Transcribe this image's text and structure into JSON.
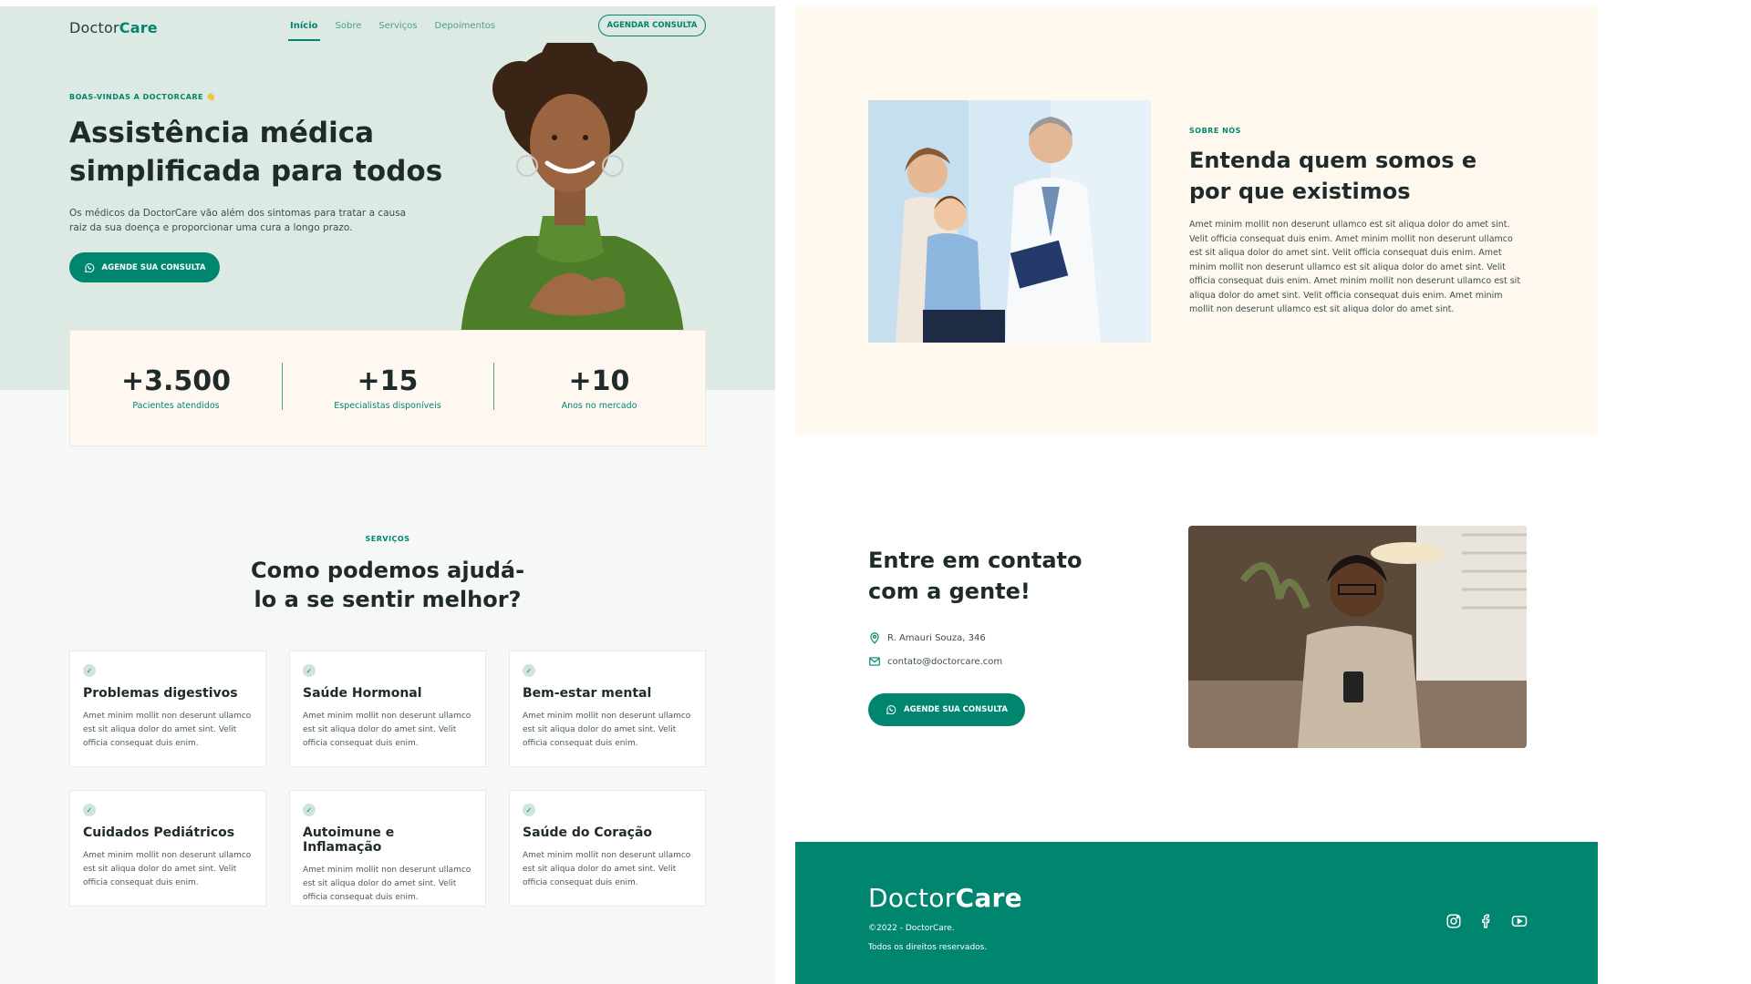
{
  "brand": {
    "name_part1": "Doctor",
    "name_part2": "Care",
    "primary": "#00856f",
    "hero_bg": "#dde9e3",
    "cream": "#fff8ef"
  },
  "nav": {
    "items": [
      "Início",
      "Sobre",
      "Serviços",
      "Depoimentos"
    ],
    "cta": "AGENDAR CONSULTA"
  },
  "hero": {
    "eyebrow": "BOAS-VINDAS A DOCTORCARE 👋",
    "title": "Assistência médica simplificada para todos",
    "text": "Os médicos da DoctorCare vão além dos sintomas para tratar a causa raiz da sua doença e proporcionar uma cura a longo prazo.",
    "button": "AGENDE SUA CONSULTA"
  },
  "stats": [
    {
      "value": "+3.500",
      "label": "Pacientes atendidos"
    },
    {
      "value": "+15",
      "label": "Especialistas disponíveis"
    },
    {
      "value": "+10",
      "label": "Anos no mercado"
    }
  ],
  "services": {
    "eyebrow": "SERVIÇOS",
    "title": "Como podemos ajudá-lo a se sentir melhor?",
    "cards": [
      {
        "title": "Problemas digestivos",
        "text": "Amet minim mollit non deserunt ullamco est sit aliqua dolor do amet sint. Velit officia consequat duis enim."
      },
      {
        "title": "Saúde Hormonal",
        "text": "Amet minim mollit non deserunt ullamco est sit aliqua dolor do amet sint. Velit officia consequat duis enim."
      },
      {
        "title": "Bem-estar mental",
        "text": "Amet minim mollit non deserunt ullamco est sit aliqua dolor do amet sint. Velit officia consequat duis enim."
      },
      {
        "title": "Cuidados Pediátricos",
        "text": "Amet minim mollit non deserunt ullamco est sit aliqua dolor do amet sint. Velit officia consequat duis enim."
      },
      {
        "title": "Autoimune e Inflamação",
        "text": "Amet minim mollit non deserunt ullamco est sit aliqua dolor do amet sint. Velit officia consequat duis enim."
      },
      {
        "title": "Saúde do Coração",
        "text": "Amet minim mollit non deserunt ullamco est sit aliqua dolor do amet sint. Velit officia consequat duis enim."
      }
    ]
  },
  "about": {
    "eyebrow": "SOBRE NÓS",
    "title": "Entenda quem somos e por que existimos",
    "text": "Amet minim mollit non deserunt ullamco est sit aliqua dolor do amet sint. Velit officia consequat duis enim. Amet minim mollit non deserunt ullamco est sit aliqua dolor do amet sint. Velit officia consequat duis enim. Amet minim mollit non deserunt ullamco est sit aliqua dolor do amet sint. Velit officia consequat duis enim. Amet minim mollit non deserunt ullamco est sit aliqua dolor do amet sint. Velit officia consequat duis enim. Amet minim mollit non deserunt ullamco est sit aliqua dolor do amet sint."
  },
  "contact": {
    "title": "Entre em contato com a gente!",
    "address": "R. Amauri Souza, 346",
    "email": "contato@doctorcare.com",
    "button": "AGENDE SUA CONSULTA"
  },
  "footer": {
    "copyright": "©2022 - DoctorCare.",
    "rights": "Todos os direitos reservados.",
    "socials": [
      "instagram-icon",
      "facebook-icon",
      "youtube-icon"
    ]
  }
}
